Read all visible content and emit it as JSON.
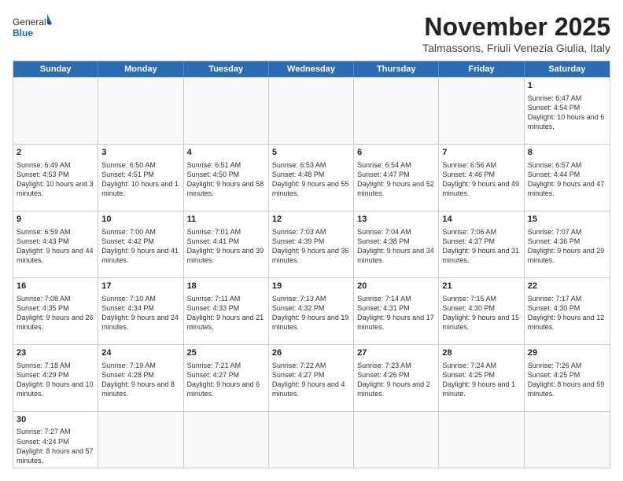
{
  "logo": {
    "text_general": "General",
    "text_blue": "Blue"
  },
  "title": "November 2025",
  "location": "Talmassons, Friuli Venezia Giulia, Italy",
  "days_of_week": [
    "Sunday",
    "Monday",
    "Tuesday",
    "Wednesday",
    "Thursday",
    "Friday",
    "Saturday"
  ],
  "weeks": [
    [
      {
        "day": "",
        "info": ""
      },
      {
        "day": "",
        "info": ""
      },
      {
        "day": "",
        "info": ""
      },
      {
        "day": "",
        "info": ""
      },
      {
        "day": "",
        "info": ""
      },
      {
        "day": "",
        "info": ""
      },
      {
        "day": "1",
        "info": "Sunrise: 6:47 AM\nSunset: 4:54 PM\nDaylight: 10 hours and 6 minutes."
      }
    ],
    [
      {
        "day": "2",
        "info": "Sunrise: 6:49 AM\nSunset: 4:53 PM\nDaylight: 10 hours and 3 minutes."
      },
      {
        "day": "3",
        "info": "Sunrise: 6:50 AM\nSunset: 4:51 PM\nDaylight: 10 hours and 1 minute."
      },
      {
        "day": "4",
        "info": "Sunrise: 6:51 AM\nSunset: 4:50 PM\nDaylight: 9 hours and 58 minutes."
      },
      {
        "day": "5",
        "info": "Sunrise: 6:53 AM\nSunset: 4:48 PM\nDaylight: 9 hours and 55 minutes."
      },
      {
        "day": "6",
        "info": "Sunrise: 6:54 AM\nSunset: 4:47 PM\nDaylight: 9 hours and 52 minutes."
      },
      {
        "day": "7",
        "info": "Sunrise: 6:56 AM\nSunset: 4:46 PM\nDaylight: 9 hours and 49 minutes."
      },
      {
        "day": "8",
        "info": "Sunrise: 6:57 AM\nSunset: 4:44 PM\nDaylight: 9 hours and 47 minutes."
      }
    ],
    [
      {
        "day": "9",
        "info": "Sunrise: 6:59 AM\nSunset: 4:43 PM\nDaylight: 9 hours and 44 minutes."
      },
      {
        "day": "10",
        "info": "Sunrise: 7:00 AM\nSunset: 4:42 PM\nDaylight: 9 hours and 41 minutes."
      },
      {
        "day": "11",
        "info": "Sunrise: 7:01 AM\nSunset: 4:41 PM\nDaylight: 9 hours and 39 minutes."
      },
      {
        "day": "12",
        "info": "Sunrise: 7:03 AM\nSunset: 4:39 PM\nDaylight: 9 hours and 36 minutes."
      },
      {
        "day": "13",
        "info": "Sunrise: 7:04 AM\nSunset: 4:38 PM\nDaylight: 9 hours and 34 minutes."
      },
      {
        "day": "14",
        "info": "Sunrise: 7:06 AM\nSunset: 4:37 PM\nDaylight: 9 hours and 31 minutes."
      },
      {
        "day": "15",
        "info": "Sunrise: 7:07 AM\nSunset: 4:36 PM\nDaylight: 9 hours and 29 minutes."
      }
    ],
    [
      {
        "day": "16",
        "info": "Sunrise: 7:08 AM\nSunset: 4:35 PM\nDaylight: 9 hours and 26 minutes."
      },
      {
        "day": "17",
        "info": "Sunrise: 7:10 AM\nSunset: 4:34 PM\nDaylight: 9 hours and 24 minutes."
      },
      {
        "day": "18",
        "info": "Sunrise: 7:11 AM\nSunset: 4:33 PM\nDaylight: 9 hours and 21 minutes."
      },
      {
        "day": "19",
        "info": "Sunrise: 7:13 AM\nSunset: 4:32 PM\nDaylight: 9 hours and 19 minutes."
      },
      {
        "day": "20",
        "info": "Sunrise: 7:14 AM\nSunset: 4:31 PM\nDaylight: 9 hours and 17 minutes."
      },
      {
        "day": "21",
        "info": "Sunrise: 7:15 AM\nSunset: 4:30 PM\nDaylight: 9 hours and 15 minutes."
      },
      {
        "day": "22",
        "info": "Sunrise: 7:17 AM\nSunset: 4:30 PM\nDaylight: 9 hours and 12 minutes."
      }
    ],
    [
      {
        "day": "23",
        "info": "Sunrise: 7:18 AM\nSunset: 4:29 PM\nDaylight: 9 hours and 10 minutes."
      },
      {
        "day": "24",
        "info": "Sunrise: 7:19 AM\nSunset: 4:28 PM\nDaylight: 9 hours and 8 minutes."
      },
      {
        "day": "25",
        "info": "Sunrise: 7:21 AM\nSunset: 4:27 PM\nDaylight: 9 hours and 6 minutes."
      },
      {
        "day": "26",
        "info": "Sunrise: 7:22 AM\nSunset: 4:27 PM\nDaylight: 9 hours and 4 minutes."
      },
      {
        "day": "27",
        "info": "Sunrise: 7:23 AM\nSunset: 4:26 PM\nDaylight: 9 hours and 2 minutes."
      },
      {
        "day": "28",
        "info": "Sunrise: 7:24 AM\nSunset: 4:25 PM\nDaylight: 9 hours and 1 minute."
      },
      {
        "day": "29",
        "info": "Sunrise: 7:26 AM\nSunset: 4:25 PM\nDaylight: 8 hours and 59 minutes."
      }
    ],
    [
      {
        "day": "30",
        "info": "Sunrise: 7:27 AM\nSunset: 4:24 PM\nDaylight: 8 hours and 57 minutes."
      },
      {
        "day": "",
        "info": ""
      },
      {
        "day": "",
        "info": ""
      },
      {
        "day": "",
        "info": ""
      },
      {
        "day": "",
        "info": ""
      },
      {
        "day": "",
        "info": ""
      },
      {
        "day": "",
        "info": ""
      }
    ]
  ]
}
